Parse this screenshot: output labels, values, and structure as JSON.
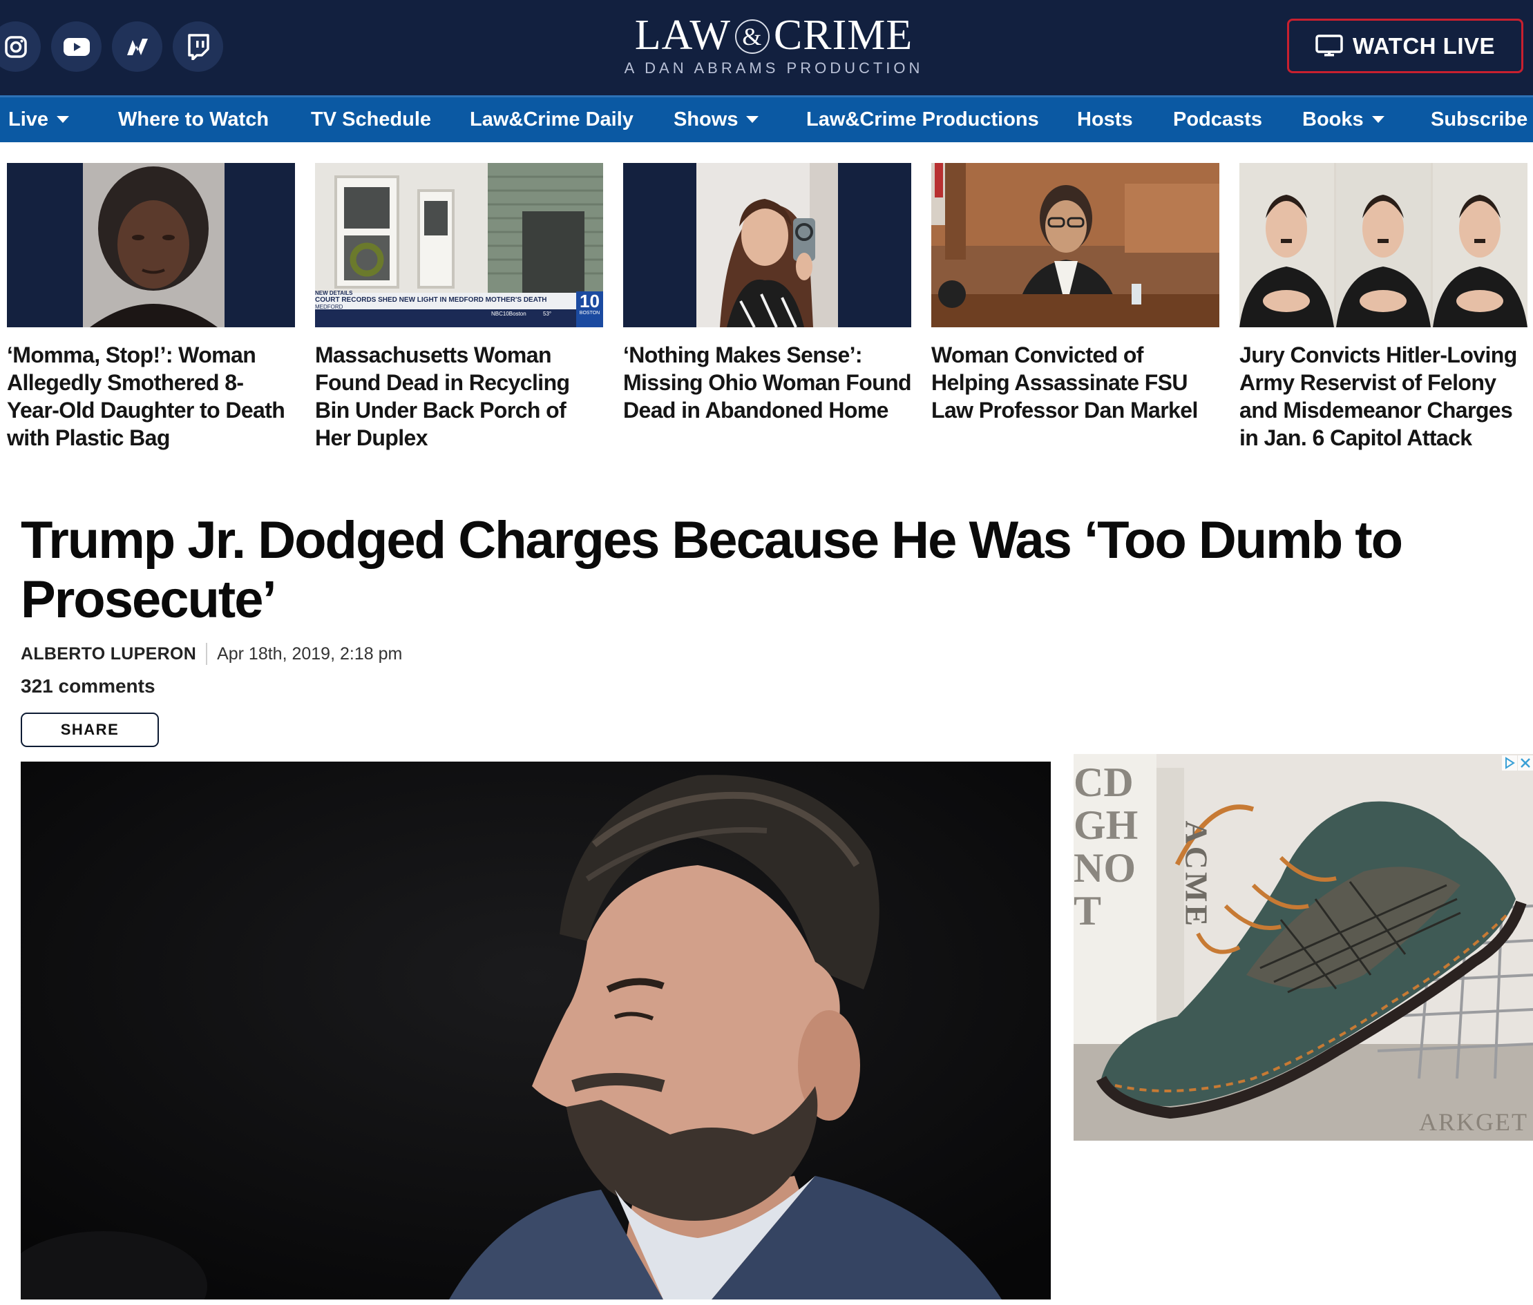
{
  "header": {
    "social": [
      {
        "name": "instagram-icon"
      },
      {
        "name": "youtube-icon"
      },
      {
        "name": "newsmax-icon"
      },
      {
        "name": "twitch-icon"
      }
    ],
    "logo_left": "LAW",
    "logo_amp": "&",
    "logo_right": "CRIME",
    "logo_tagline": "A DAN ABRAMS PRODUCTION",
    "watch_live_label": "WATCH LIVE"
  },
  "nav": {
    "items": [
      {
        "label": "Live",
        "dropdown": true
      },
      {
        "label": "Where to Watch",
        "dropdown": false
      },
      {
        "label": "TV Schedule",
        "dropdown": false
      },
      {
        "label": "Law&Crime Daily",
        "dropdown": false
      },
      {
        "label": "Shows",
        "dropdown": true
      },
      {
        "label": "Law&Crime Productions",
        "dropdown": false
      },
      {
        "label": "Hosts",
        "dropdown": false
      },
      {
        "label": "Podcasts",
        "dropdown": false
      },
      {
        "label": "Books",
        "dropdown": true
      },
      {
        "label": "Subscribe",
        "dropdown": false
      }
    ]
  },
  "trending": [
    {
      "title": "‘Momma, Stop!’: Woman Allegedly Smothered 8-Year-Old Daughter to Death with Plastic Bag"
    },
    {
      "title": "Massachusetts Woman Found Dead in Recycling Bin Under Back Porch of Her Duplex",
      "thumb_text": {
        "lower_third_small": "NEW DETAILS",
        "lower_third": "COURT RECORDS SHED NEW LIGHT IN MEDFORD MOTHER'S DEATH",
        "location": "MEDFORD",
        "channel": "10",
        "channel_city": "BOSTON",
        "handle": "NBC10Boston",
        "temp": "53°"
      }
    },
    {
      "title": "‘Nothing Makes Sense’: Missing Ohio Woman Found Dead in Abandoned Home"
    },
    {
      "title": "Woman Convicted of Helping Assassinate FSU Law Professor Dan Markel"
    },
    {
      "title": "Jury Convicts Hitler-Loving Army Reservist of Felony and Misdemeanor Charges in Jan. 6 Capitol Attack"
    }
  ],
  "article": {
    "headline": "Trump Jr. Dodged Charges Because He Was ‘Too Dumb to Prosecute’",
    "author": "ALBERTO LUPERON",
    "date": "Apr 18th, 2019, 2:18 pm",
    "comments": "321 comments",
    "share_label": "SHARE"
  },
  "ad": {
    "book_spine": "ACME",
    "book_cover_letters": "CD GH NO T",
    "brand_watermark": "ARKGET",
    "colors": {
      "shoe_leather": "#3f5a55",
      "shoe_accent": "#c77a34"
    }
  },
  "colors": {
    "header_bg": "#12203f",
    "nav_bg": "#0b59a3",
    "live_border": "#c8202f"
  }
}
